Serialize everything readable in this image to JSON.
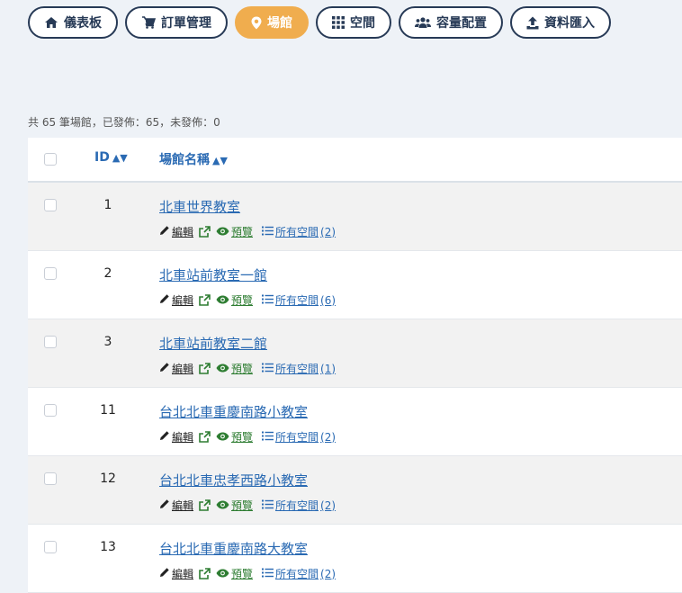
{
  "nav": [
    {
      "key": "dashboard",
      "label": "儀表板",
      "icon": "home-icon",
      "active": false
    },
    {
      "key": "orders",
      "label": "訂單管理",
      "icon": "cart-icon",
      "active": false
    },
    {
      "key": "venues",
      "label": "場館",
      "icon": "map-marker-icon",
      "active": true
    },
    {
      "key": "spaces",
      "label": "空間",
      "icon": "grid-icon",
      "active": false
    },
    {
      "key": "capacity",
      "label": "容量配置",
      "icon": "users-icon",
      "active": false
    },
    {
      "key": "import",
      "label": "資料匯入",
      "icon": "upload-icon",
      "active": false
    }
  ],
  "summary": "共 65 筆場館，已發佈：65，未發佈：0",
  "table": {
    "col_id": "ID",
    "col_name": "場館名稱",
    "sort_icon": "sort-icon",
    "actions": {
      "edit": "編輯",
      "preview": "預覽",
      "spaces_prefix": "所有空間"
    },
    "rows": [
      {
        "id": "1",
        "name": "北車世界教室",
        "spaces": "(2)"
      },
      {
        "id": "2",
        "name": "北車站前教室一館",
        "spaces": "(6)"
      },
      {
        "id": "3",
        "name": "北車站前教室二館",
        "spaces": "(1)"
      },
      {
        "id": "11",
        "name": "台北北車重慶南路小教室",
        "spaces": "(2)"
      },
      {
        "id": "12",
        "name": "台北北車忠孝西路小教室",
        "spaces": "(2)"
      },
      {
        "id": "13",
        "name": "台北北車重慶南路大教室",
        "spaces": "(2)"
      }
    ]
  },
  "colors": {
    "primary": "#273a56",
    "active": "#f0ad4e",
    "link": "#2a6ab3",
    "preview": "#2e7d32",
    "background": "#eef2f7"
  }
}
